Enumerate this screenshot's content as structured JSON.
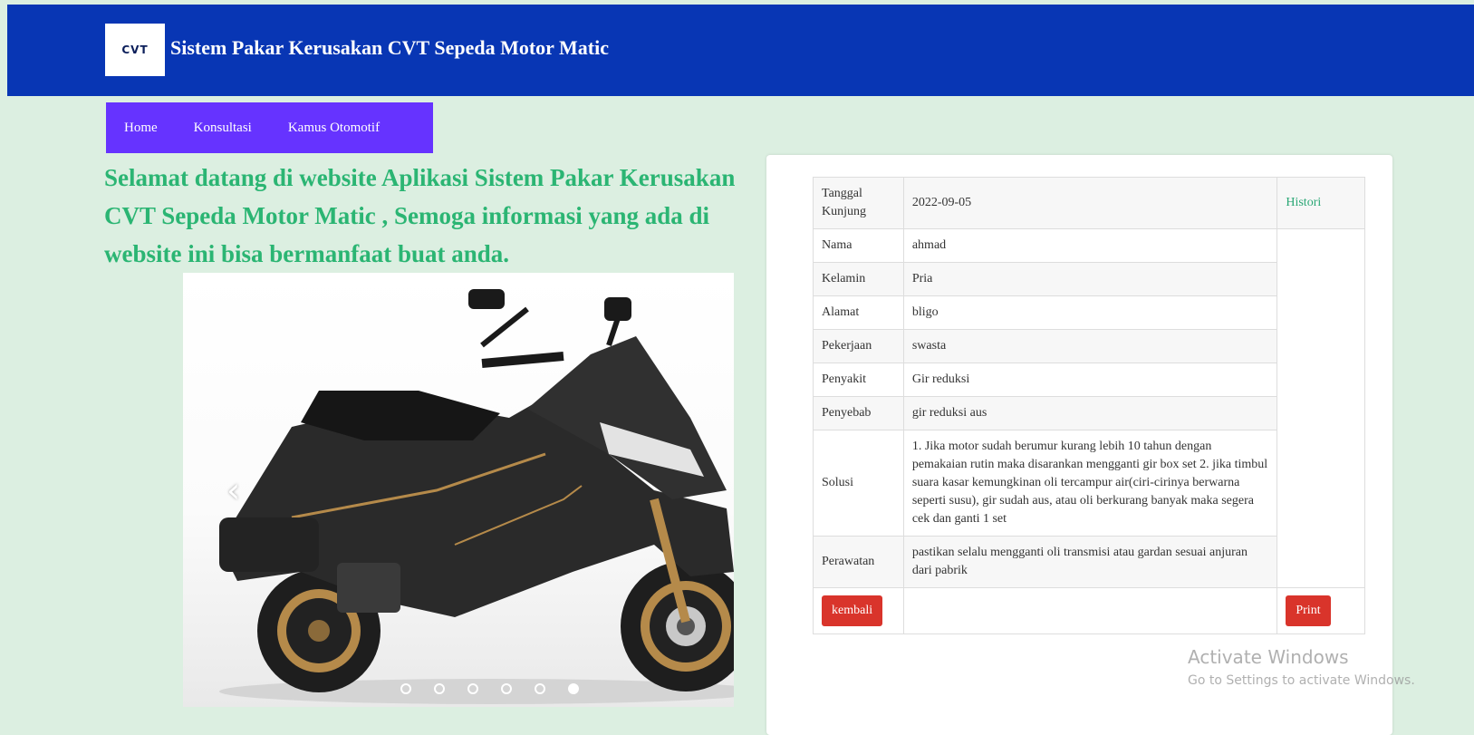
{
  "header": {
    "logo_text": "CVT",
    "title": "Sistem Pakar Kerusakan CVT Sepeda Motor Matic"
  },
  "nav": {
    "items": [
      {
        "label": "Home"
      },
      {
        "label": "Konsultasi"
      },
      {
        "label": "Kamus Otomotif"
      }
    ]
  },
  "welcome_text": "Selamat datang di website Aplikasi Sistem Pakar Kerusakan CVT Sepeda Motor Matic , Semoga informasi yang ada di website ini bisa bermanfaat buat anda.",
  "carousel": {
    "prev_icon": "‹",
    "slide_count": 6,
    "active_index": 5
  },
  "details": {
    "tanggal_label": "Tanggal Kunjung",
    "tanggal_value": "2022-09-05",
    "histori_label": "Histori",
    "nama_label": "Nama",
    "nama_value": "ahmad",
    "kelamin_label": "Kelamin",
    "kelamin_value": "Pria",
    "alamat_label": "Alamat",
    "alamat_value": "bligo",
    "pekerjaan_label": "Pekerjaan",
    "pekerjaan_value": "swasta",
    "penyakit_label": "Penyakit",
    "penyakit_value": "Gir reduksi",
    "penyebab_label": "Penyebab",
    "penyebab_value": "gir reduksi aus",
    "solusi_label": "Solusi",
    "solusi_value": "1. Jika motor sudah berumur kurang lebih 10 tahun dengan pemakaian rutin maka disarankan mengganti gir box set 2. jika timbul suara kasar kemungkinan oli tercampur air(ciri-cirinya berwarna seperti susu), gir sudah aus, atau oli berkurang banyak maka segera cek dan ganti 1 set",
    "perawatan_label": "Perawatan",
    "perawatan_value": "pastikan selalu mengganti oli transmisi atau gardan sesuai anjuran dari pabrik"
  },
  "buttons": {
    "kembali": "kembali",
    "print": "Print"
  },
  "watermark": {
    "line1": "Activate Windows",
    "line2": "Go to Settings to activate Windows."
  },
  "colors": {
    "header_bg": "#0836b4",
    "nav_bg": "#6633ff",
    "page_bg": "#dcefe1",
    "welcome_text": "#2bb573",
    "button_red": "#d9342b"
  }
}
